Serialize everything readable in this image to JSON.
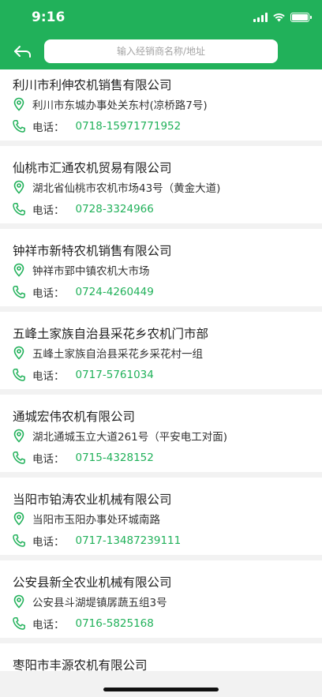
{
  "status_bar": {
    "time": "9:16"
  },
  "header": {
    "search_placeholder": "输入经销商名称/地址"
  },
  "colors": {
    "brand": "#21b15a",
    "background": "#f2f2f2"
  },
  "dealers": [
    {
      "name": "利川市利伸农机销售有限公司",
      "address": "利川市东城办事处关东村(凉桥路7号)",
      "tel_label": "电话：",
      "tel": "0718-15971771952"
    },
    {
      "name": "仙桃市汇通农机贸易有限公司",
      "address": "湖北省仙桃市农机市场43号（黄金大道)",
      "tel_label": "电话：",
      "tel": "0728-3324966"
    },
    {
      "name": "钟祥市新特农机销售有限公司",
      "address": "钟祥市郢中镇农机大市场",
      "tel_label": "电话：",
      "tel": "0724-4260449"
    },
    {
      "name": "五峰土家族自治县采花乡农机门市部",
      "address": "五峰土家族自治县采花乡采花村一组",
      "tel_label": "电话：",
      "tel": "0717-5761034"
    },
    {
      "name": "通城宏伟农机有限公司",
      "address": "湖北通城玉立大道261号（平安电工对面)",
      "tel_label": "电话：",
      "tel": "0715-4328152"
    },
    {
      "name": "当阳市铂涛农业机械有限公司",
      "address": "当阳市玉阳办事处环城南路",
      "tel_label": "电话：",
      "tel": "0717-13487239111"
    },
    {
      "name": "公安县新全农业机械有限公司",
      "address": "公安县斗湖堤镇孱蔬五组3号",
      "tel_label": "电话：",
      "tel": "0716-5825168"
    },
    {
      "name": "枣阳市丰源农机有限公司"
    }
  ]
}
